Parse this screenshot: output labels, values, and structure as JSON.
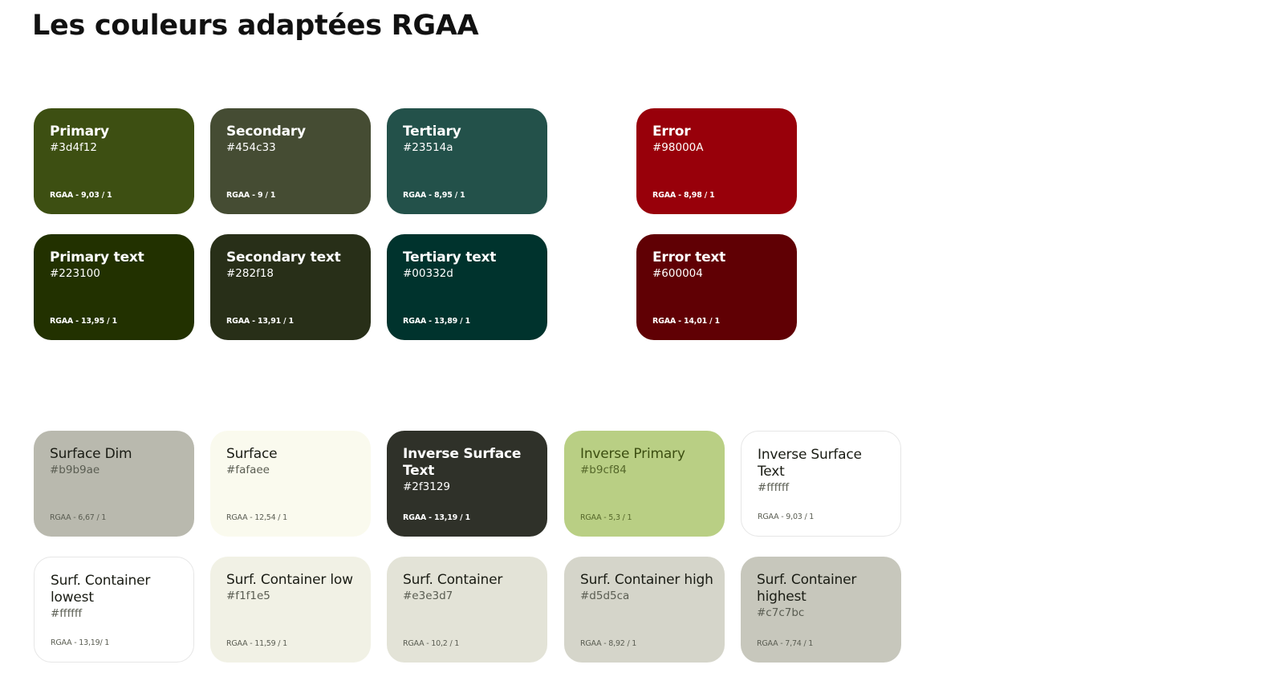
{
  "title": "Les couleurs adaptées RGAA",
  "main_palette": {
    "primary": {
      "name": "Primary",
      "hex": "#3d4f12",
      "ratio": "RGAA - 9,03 / 1",
      "color": "#3d4f12"
    },
    "secondary": {
      "name": "Secondary",
      "hex": "#454c33",
      "ratio": "RGAA - 9 / 1",
      "color": "#454c33"
    },
    "tertiary": {
      "name": "Tertiary",
      "hex": "#23514a",
      "ratio": "RGAA - 8,95 / 1",
      "color": "#23514a"
    },
    "error": {
      "name": "Error",
      "hex": "#98000A",
      "ratio": "RGAA - 8,98 / 1",
      "color": "#98000a"
    },
    "primary_text": {
      "name": "Primary text",
      "hex": "#223100",
      "ratio": "RGAA - 13,95 / 1",
      "color": "#223100"
    },
    "secondary_text": {
      "name": "Secondary text",
      "hex": "#282f18",
      "ratio": "RGAA - 13,91 / 1",
      "color": "#282f18"
    },
    "tertiary_text": {
      "name": "Tertiary text",
      "hex": "#00332d",
      "ratio": "RGAA - 13,89 / 1",
      "color": "#00332d"
    },
    "error_text": {
      "name": "Error text",
      "hex": "#600004",
      "ratio": "RGAA - 14,01 / 1",
      "color": "#600004"
    }
  },
  "surface_palette": {
    "surface_dim": {
      "name": "Surface Dim",
      "hex": "#b9b9ae",
      "ratio": "RGAA - 6,67 / 1",
      "color": "#b9b9ae"
    },
    "surface": {
      "name": "Surface",
      "hex": "#fafaee",
      "ratio": "RGAA - 12,54 / 1",
      "color": "#fafaee"
    },
    "inverse_surface_text": {
      "name": "Inverse Surface Text",
      "hex": "#2f3129",
      "ratio": "RGAA - 13,19 / 1",
      "color": "#2f3129"
    },
    "inverse_primary": {
      "name": "Inverse Primary",
      "hex": "#b9cf84",
      "ratio": "RGAA - 5,3 / 1",
      "color": "#b9cf84"
    },
    "inverse_surface_text_2": {
      "name": "Inverse Surface Text",
      "hex": "#ffffff",
      "ratio": "RGAA - 9,03 / 1",
      "color": "#ffffff"
    },
    "container_lowest": {
      "name": "Surf. Container lowest",
      "hex": "#ffffff",
      "ratio": "RGAA - 13,19/ 1",
      "color": "#ffffff"
    },
    "container_low": {
      "name": "Surf. Container low",
      "hex": "#f1f1e5",
      "ratio": "RGAA - 11,59 / 1",
      "color": "#f1f1e5"
    },
    "container": {
      "name": "Surf. Container",
      "hex": "#e3e3d7",
      "ratio": "RGAA - 10,2 / 1",
      "color": "#e3e3d7"
    },
    "container_high": {
      "name": "Surf. Container high",
      "hex": "#d5d5ca",
      "ratio": "RGAA - 8,92 / 1",
      "color": "#d5d5ca"
    },
    "container_highest": {
      "name": "Surf. Container highest",
      "hex": "#c7c7bc",
      "ratio": "RGAA - 7,74 / 1",
      "color": "#c7c7bc"
    }
  }
}
